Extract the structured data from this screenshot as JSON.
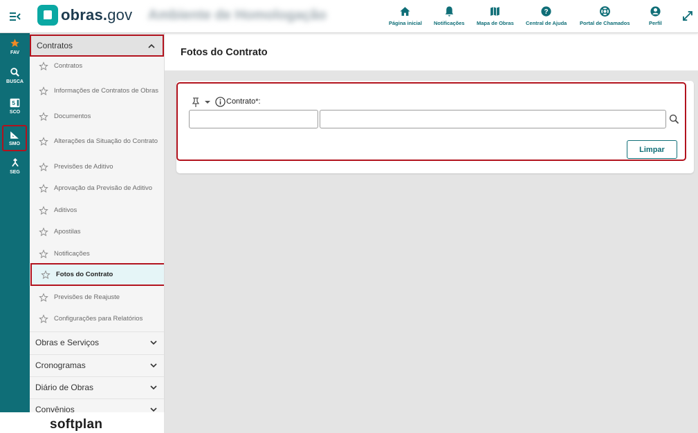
{
  "header": {
    "logo_name": "obras.",
    "logo_suffix": "gov",
    "environment_label": "Ambiente de Homologação",
    "nav": [
      {
        "label": "Página inicial",
        "icon": "home-icon"
      },
      {
        "label": "Notificações",
        "icon": "bell-icon"
      },
      {
        "label": "Mapa de Obras",
        "icon": "map-icon"
      },
      {
        "label": "Central de Ajuda",
        "icon": "help-icon"
      },
      {
        "label": "Portal de Chamados",
        "icon": "lifebuoy-icon"
      },
      {
        "label": "Perfil",
        "icon": "user-icon"
      }
    ]
  },
  "rail": {
    "items": [
      {
        "label": "FAV",
        "icon": "star-icon"
      },
      {
        "label": "BUSCA",
        "icon": "search-icon"
      },
      {
        "label": "SCO",
        "icon": "calendar-icon",
        "badge": "5"
      },
      {
        "label": "SMO",
        "icon": "ruler-icon"
      },
      {
        "label": "SEG",
        "icon": "merge-icon"
      }
    ],
    "brand": "softplan"
  },
  "sidemenu": {
    "section": "Contratos",
    "items": [
      "Contratos",
      "Informações de Contratos de Obras",
      "Documentos",
      "Alterações da Situação do Contrato",
      "Previsões de Aditivo",
      "Aprovação da Previsão de Aditivo",
      "Aditivos",
      "Apostilas",
      "Notificações",
      "Fotos do Contrato",
      "Previsões de Reajuste",
      "Configurações para Relatórios"
    ],
    "active_item": "Fotos do Contrato",
    "groups": [
      "Obras e Serviços",
      "Cronogramas",
      "Diário de Obras",
      "Convênios"
    ]
  },
  "page": {
    "title": "Fotos do Contrato",
    "field_label": "Contrato*:",
    "code_value": "",
    "description_value": "",
    "clear_button": "Limpar"
  },
  "colors": {
    "primary": "#0f6e77",
    "accent": "#0aa8a3",
    "highlight": "#b2121d",
    "fav_star": "#f08a24"
  }
}
